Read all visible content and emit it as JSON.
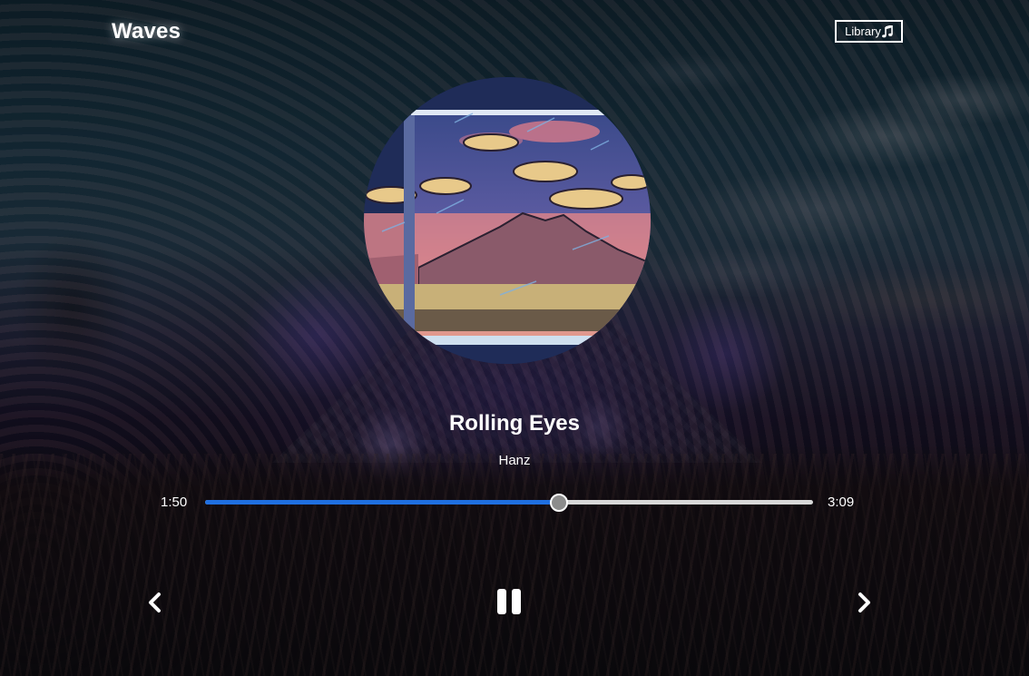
{
  "app": {
    "title": "Waves"
  },
  "header": {
    "library_label": "Library",
    "library_icon": "music-note-icon"
  },
  "song": {
    "title": "Rolling Eyes",
    "artist": "Hanz"
  },
  "player": {
    "current_time": "1:50",
    "total_time": "3:09",
    "progress_fraction": 0.58,
    "is_playing": true,
    "controls": {
      "previous_icon": "chevron-left-icon",
      "pause_icon": "pause-icon",
      "next_icon": "chevron-right-icon"
    }
  },
  "colors": {
    "progress_fill": "#1f6fe0",
    "progress_track": "#d8d8d8",
    "text": "#ffffff"
  }
}
